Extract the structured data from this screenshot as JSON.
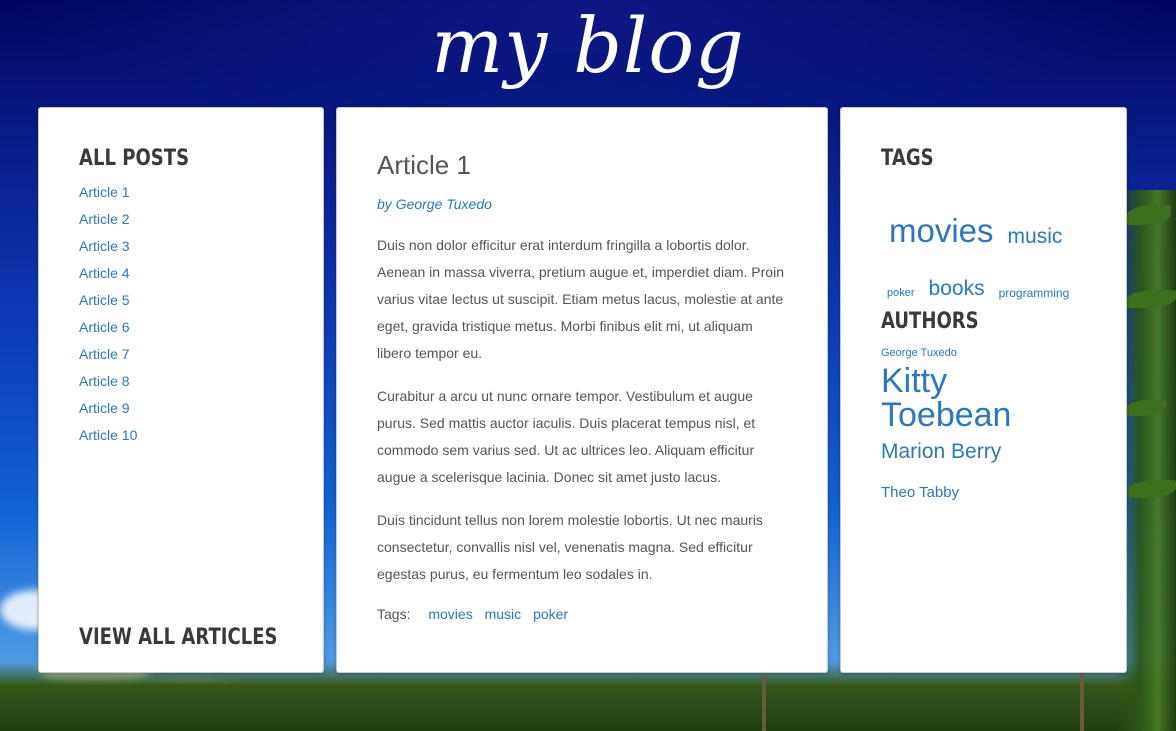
{
  "site": {
    "title": "my blog"
  },
  "left_panel": {
    "heading": "ALL POSTS",
    "articles": [
      "Article 1",
      "Article 2",
      "Article 3",
      "Article 4",
      "Article 5",
      "Article 6",
      "Article 7",
      "Article 8",
      "Article 9",
      "Article 10"
    ],
    "view_all": "VIEW ALL ARTICLES"
  },
  "article": {
    "title": "Article 1",
    "byline": "by George Tuxedo",
    "paragraphs": [
      "Duis non dolor efficitur erat interdum fringilla a lobortis dolor. Aenean in massa viverra, pretium augue et, imperdiet diam. Proin varius vitae lectus ut suscipit. Etiam metus lacus, molestie at ante eget, gravida tristique metus. Morbi finibus elit mi, ut aliquam libero tempor eu.",
      "Curabitur a arcu ut nunc ornare tempor. Vestibulum et augue purus. Sed mattis auctor iaculis. Duis placerat tempus nisl, et commodo sem varius sed. Ut ac ultrices leo. Aliquam efficitur augue a scelerisque lacinia. Donec sit amet justo lacus.",
      "Duis tincidunt tellus non lorem molestie lobortis. Ut nec mauris consectetur, convallis nisl vel, venenatis magna. Sed efficitur egestas purus, eu fermentum leo sodales in."
    ],
    "tags_label": "Tags:",
    "tags": [
      "movies",
      "music",
      "poker"
    ]
  },
  "right_panel": {
    "tags_heading": "TAGS",
    "tag_cloud": [
      "movies",
      "music",
      "poker",
      "books",
      "programming"
    ],
    "authors_heading": "AUTHORS",
    "authors": [
      "George Tuxedo",
      "Kitty Toebean",
      "Marion Berry",
      "Theo Tabby"
    ]
  },
  "colors": {
    "link": "#2a78c4",
    "heading": "#3a3a3a",
    "text": "#555555"
  }
}
